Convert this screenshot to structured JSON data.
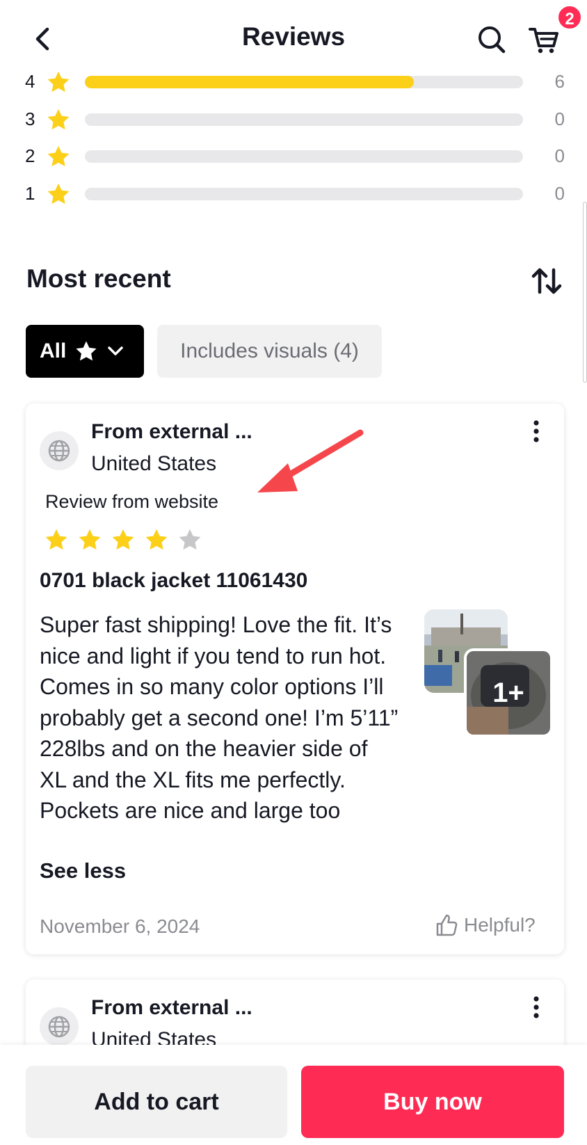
{
  "header": {
    "title": "Reviews",
    "cart_count": "2"
  },
  "ratings": [
    {
      "stars": "4",
      "count": "6",
      "fraction": 0.75
    },
    {
      "stars": "3",
      "count": "0",
      "fraction": 0
    },
    {
      "stars": "2",
      "count": "0",
      "fraction": 0
    },
    {
      "stars": "1",
      "count": "0",
      "fraction": 0
    }
  ],
  "section": {
    "title": "Most recent"
  },
  "filters": {
    "all_label": "All",
    "visuals_label": "Includes visuals (4)"
  },
  "reviews": [
    {
      "reviewer": "From external ...",
      "country": "United States",
      "source": "Review from  website",
      "rating": 4,
      "rating_max": 5,
      "product": "0701 black jacket 11061430",
      "text": "Super fast shipping! Love the fit. It’s nice and light if you tend to run hot. Comes in so many color options I’ll probably get a second one! I’m 5’11” 228lbs and on the heavier side of XL and the XL fits me perfectly. Pockets are nice and large too",
      "see_less": "See less",
      "more_photos": "1+",
      "date": "November 6, 2024",
      "helpful": "Helpful?"
    },
    {
      "reviewer": "From external ...",
      "country": "United States"
    }
  ],
  "actions": {
    "add_to_cart": "Add to cart",
    "buy_now": "Buy now"
  },
  "colors": {
    "star": "#fcd019",
    "star_empty": "#c7c7c9",
    "accent": "#fe2c55",
    "annotation_arrow": "#f5474b"
  },
  "icons": [
    "back-arrow-icon",
    "search-icon",
    "cart-icon",
    "sort-icon",
    "star-icon",
    "chevron-down-icon",
    "globe-icon",
    "more-vertical-icon",
    "thumbs-up-icon"
  ]
}
